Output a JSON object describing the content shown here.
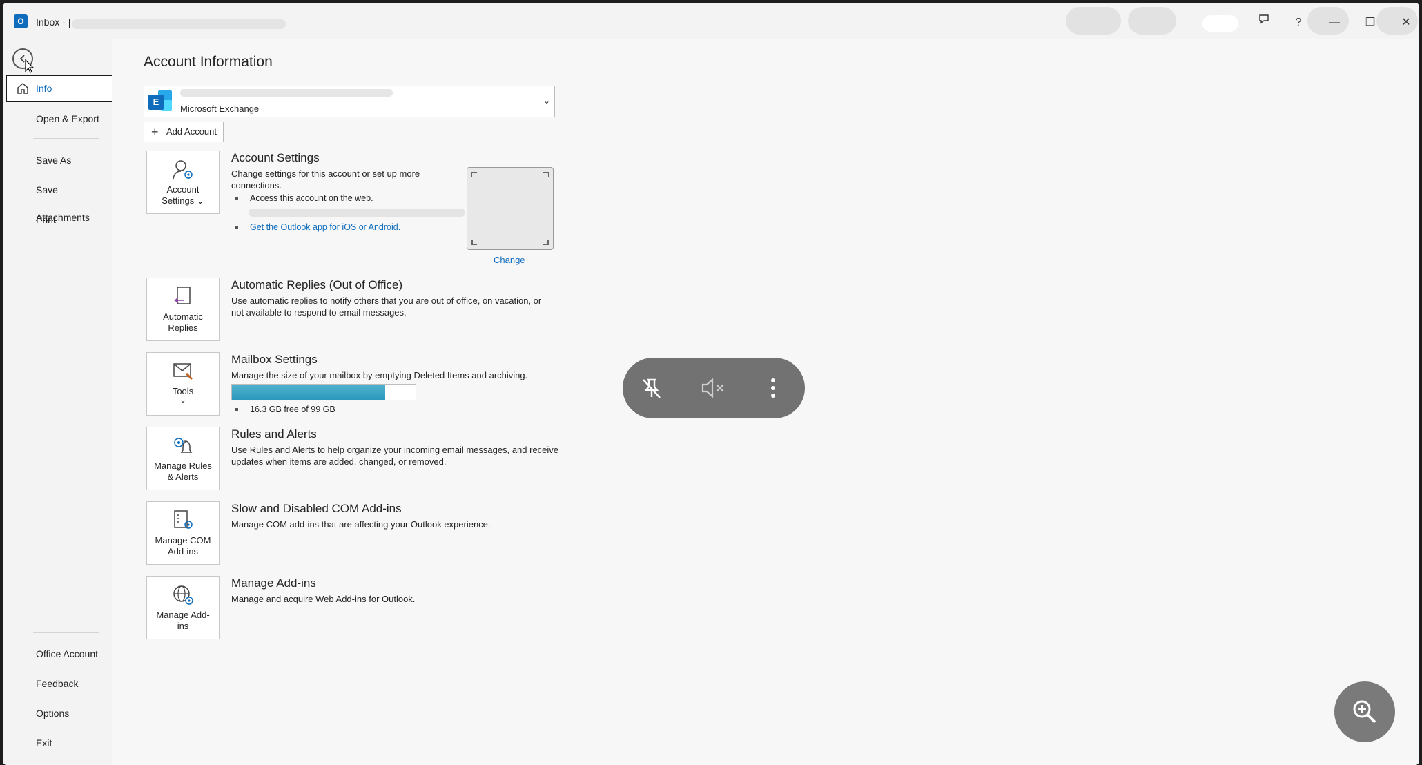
{
  "window": {
    "title": "Inbox - |",
    "minimize": "—",
    "restore": "❐",
    "close": "✕",
    "help": "?"
  },
  "sidebar": {
    "items": [
      {
        "label": "Info"
      },
      {
        "label": "Open & Export"
      },
      {
        "label": "Save As"
      },
      {
        "label": "Save Attachments"
      },
      {
        "label": "Print"
      },
      {
        "label": "Office Account"
      },
      {
        "label": "Feedback"
      },
      {
        "label": "Options"
      },
      {
        "label": "Exit"
      }
    ]
  },
  "main": {
    "title": "Account Information",
    "account": {
      "type": "Microsoft Exchange",
      "logo_letter": "E",
      "chevron": "⌄"
    },
    "add_account": "Add Account",
    "account_settings": {
      "tile_label": "Account Settings ⌄",
      "title": "Account Settings",
      "desc": "Change settings for this account or set up more connections.",
      "bullet1": "Access this account on the web.",
      "link": "Get the Outlook app for iOS or Android.",
      "change": "Change"
    },
    "auto_replies": {
      "tile_label": "Automatic Replies",
      "title": "Automatic Replies (Out of Office)",
      "desc": "Use automatic replies to notify others that you are out of office, on vacation, or not available to respond to email messages."
    },
    "mailbox": {
      "tile_label": "Tools",
      "tile_chevron": "⌄",
      "title": "Mailbox Settings",
      "desc": "Manage the size of your mailbox by emptying Deleted Items and archiving.",
      "usage_fraction": 0.835,
      "free_text": "16.3 GB free of 99 GB"
    },
    "rules": {
      "tile_label": "Manage Rules & Alerts",
      "title": "Rules and Alerts",
      "desc": "Use Rules and Alerts to help organize your incoming email messages, and receive updates when items are added, changed, or removed."
    },
    "com_addins": {
      "tile_label": "Manage COM Add-ins",
      "title": "Slow and Disabled COM Add-ins",
      "desc": "Manage COM add-ins that are affecting your Outlook experience."
    },
    "addins": {
      "tile_label": "Manage Add-ins",
      "title": "Manage Add-ins",
      "desc": "Manage and acquire Web Add-ins for Outlook."
    }
  },
  "colors": {
    "accent": "#0f6cbd",
    "progress": "#2b98bd"
  }
}
